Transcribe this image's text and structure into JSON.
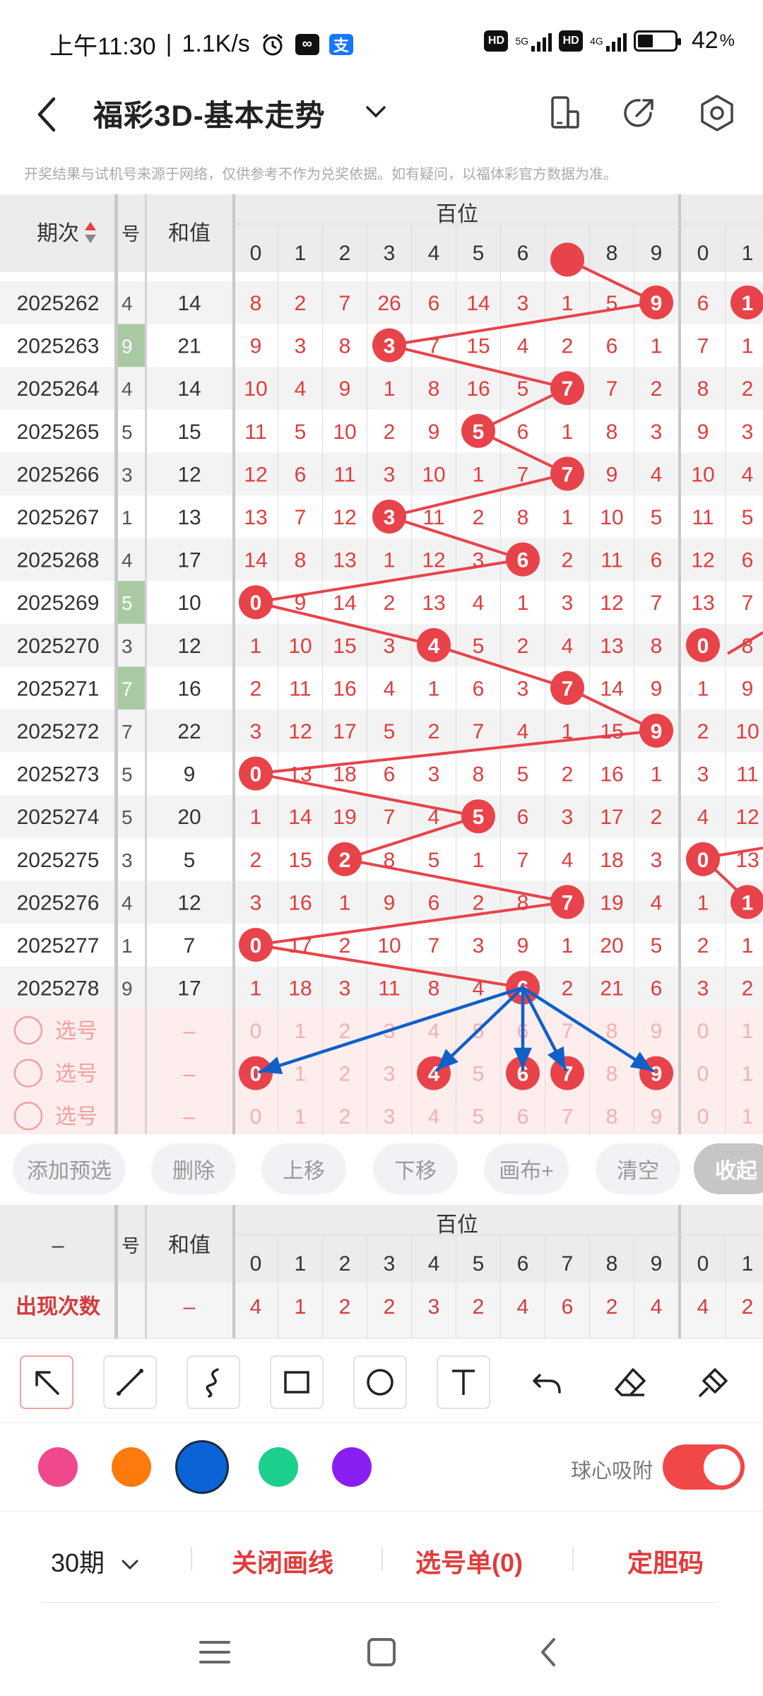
{
  "status_bar": {
    "time": "上午11:30",
    "separator": "|",
    "net_speed": "1.1K/s",
    "battery": "42",
    "battery_unit": "%",
    "hd1": "HD",
    "hd2": "HD",
    "net1": "5G",
    "net2": "4G",
    "icons": [
      "alarm-icon",
      "app-icon",
      "alipay-icon",
      "signal-icon",
      "battery-icon"
    ]
  },
  "app_bar": {
    "title": "福彩3D-基本走势"
  },
  "notice": "开奖结果与试机号来源于网络，仅供参考不作为兑奖依据。如有疑问，以福体彩官方数据为准。",
  "table": {
    "col_period": "期次",
    "col_sum": "和值",
    "group_label": "百位",
    "clip_col_label": "号",
    "digits": [
      "0",
      "1",
      "2",
      "3",
      "4",
      "5",
      "6",
      "7",
      "8",
      "9"
    ],
    "next_digits": [
      "0",
      "1"
    ],
    "rows": [
      {
        "period": "2025262",
        "clip": "4",
        "sum": "14",
        "cells": [
          "8",
          "2",
          "7",
          "26",
          "6",
          "14",
          "3",
          "1",
          "5",
          "9"
        ],
        "hit": 9,
        "next": [
          "6",
          "1"
        ],
        "next_hit": 1,
        "clip_hl": false
      },
      {
        "period": "2025263",
        "clip": "9",
        "sum": "21",
        "cells": [
          "9",
          "3",
          "8",
          "3",
          "7",
          "15",
          "4",
          "2",
          "6",
          "1"
        ],
        "hit": 3,
        "next": [
          "7",
          "1"
        ],
        "next_hit": -1,
        "clip_hl": true
      },
      {
        "period": "2025264",
        "clip": "4",
        "sum": "14",
        "cells": [
          "10",
          "4",
          "9",
          "1",
          "8",
          "16",
          "5",
          "7",
          "7",
          "2"
        ],
        "hit": 7,
        "next": [
          "8",
          "2"
        ],
        "next_hit": -1,
        "clip_hl": false
      },
      {
        "period": "2025265",
        "clip": "5",
        "sum": "15",
        "cells": [
          "11",
          "5",
          "10",
          "2",
          "9",
          "5",
          "6",
          "1",
          "8",
          "3"
        ],
        "hit": 5,
        "next": [
          "9",
          "3"
        ],
        "next_hit": -1,
        "clip_hl": false
      },
      {
        "period": "2025266",
        "clip": "3",
        "sum": "12",
        "cells": [
          "12",
          "6",
          "11",
          "3",
          "10",
          "1",
          "7",
          "7",
          "9",
          "4"
        ],
        "hit": 7,
        "next": [
          "10",
          "4"
        ],
        "next_hit": -1,
        "clip_hl": false
      },
      {
        "period": "2025267",
        "clip": "1",
        "sum": "13",
        "cells": [
          "13",
          "7",
          "12",
          "3",
          "11",
          "2",
          "8",
          "1",
          "10",
          "5"
        ],
        "hit": 3,
        "next": [
          "11",
          "5"
        ],
        "next_hit": -1,
        "clip_hl": false
      },
      {
        "period": "2025268",
        "clip": "4",
        "sum": "17",
        "cells": [
          "14",
          "8",
          "13",
          "1",
          "12",
          "3",
          "6",
          "2",
          "11",
          "6"
        ],
        "hit": 6,
        "next": [
          "12",
          "6"
        ],
        "next_hit": -1,
        "clip_hl": false
      },
      {
        "period": "2025269",
        "clip": "5",
        "sum": "10",
        "cells": [
          "0",
          "9",
          "14",
          "2",
          "13",
          "4",
          "1",
          "3",
          "12",
          "7"
        ],
        "hit": 0,
        "next": [
          "13",
          "7"
        ],
        "next_hit": -1,
        "clip_hl": true
      },
      {
        "period": "2025270",
        "clip": "3",
        "sum": "12",
        "cells": [
          "1",
          "10",
          "15",
          "3",
          "4",
          "5",
          "2",
          "4",
          "13",
          "8"
        ],
        "hit": 4,
        "next": [
          "0",
          "8"
        ],
        "next_hit": 0,
        "clip_hl": false
      },
      {
        "period": "2025271",
        "clip": "7",
        "sum": "16",
        "cells": [
          "2",
          "11",
          "16",
          "4",
          "1",
          "6",
          "3",
          "7",
          "14",
          "9"
        ],
        "hit": 7,
        "next": [
          "1",
          "9"
        ],
        "next_hit": -1,
        "clip_hl": true
      },
      {
        "period": "2025272",
        "clip": "7",
        "sum": "22",
        "cells": [
          "3",
          "12",
          "17",
          "5",
          "2",
          "7",
          "4",
          "1",
          "15",
          "9"
        ],
        "hit": 9,
        "next": [
          "2",
          "10"
        ],
        "next_hit": -1,
        "clip_hl": false
      },
      {
        "period": "2025273",
        "clip": "5",
        "sum": "9",
        "cells": [
          "0",
          "13",
          "18",
          "6",
          "3",
          "8",
          "5",
          "2",
          "16",
          "1"
        ],
        "hit": 0,
        "next": [
          "3",
          "11"
        ],
        "next_hit": -1,
        "clip_hl": false
      },
      {
        "period": "2025274",
        "clip": "5",
        "sum": "20",
        "cells": [
          "1",
          "14",
          "19",
          "7",
          "4",
          "5",
          "6",
          "3",
          "17",
          "2"
        ],
        "hit": 5,
        "next": [
          "4",
          "12"
        ],
        "next_hit": -1,
        "clip_hl": false
      },
      {
        "period": "2025275",
        "clip": "3",
        "sum": "5",
        "cells": [
          "2",
          "15",
          "2",
          "8",
          "5",
          "1",
          "7",
          "4",
          "18",
          "3"
        ],
        "hit": 2,
        "next": [
          "0",
          "13"
        ],
        "next_hit": 0,
        "clip_hl": false
      },
      {
        "period": "2025276",
        "clip": "4",
        "sum": "12",
        "cells": [
          "3",
          "16",
          "1",
          "9",
          "6",
          "2",
          "8",
          "7",
          "19",
          "4"
        ],
        "hit": 7,
        "next": [
          "1",
          "1"
        ],
        "next_hit": 1,
        "clip_hl": false
      },
      {
        "period": "2025277",
        "clip": "1",
        "sum": "7",
        "cells": [
          "0",
          "17",
          "2",
          "10",
          "7",
          "3",
          "9",
          "1",
          "20",
          "5"
        ],
        "hit": 0,
        "next": [
          "2",
          "1"
        ],
        "next_hit": -1,
        "clip_hl": false
      },
      {
        "period": "2025278",
        "clip": "9",
        "sum": "17",
        "cells": [
          "1",
          "18",
          "3",
          "11",
          "8",
          "4",
          "6",
          "2",
          "21",
          "6"
        ],
        "hit": 6,
        "next": [
          "3",
          "2"
        ],
        "next_hit": -1,
        "clip_hl": false
      }
    ],
    "select_rows": [
      {
        "label": "选号",
        "sum": "–",
        "picked": []
      },
      {
        "label": "选号",
        "sum": "–",
        "picked": [
          0,
          4,
          6,
          7,
          9
        ]
      },
      {
        "label": "选号",
        "sum": "–",
        "picked": []
      }
    ]
  },
  "buttons": [
    "添加预选",
    "删除",
    "上移",
    "下移",
    "画布+",
    "清空",
    "收起"
  ],
  "stats": {
    "header_left": "–",
    "col_sum": "和值",
    "group_label": "百位",
    "clip_col_label": "号",
    "row_label": "出现次数",
    "row_sum": "–",
    "counts": [
      "4",
      "1",
      "2",
      "2",
      "3",
      "2",
      "4",
      "6",
      "2",
      "4"
    ],
    "next_counts": [
      "4",
      "2"
    ]
  },
  "tools": [
    "pointer-arrow",
    "line",
    "freehand",
    "rectangle",
    "circle",
    "text",
    "undo",
    "eraser",
    "clear-all"
  ],
  "colors": {
    "swatches": [
      "#f0488c",
      "#ff7a0d",
      "#0a64d6",
      "#1ccf8c",
      "#8a1ef0"
    ],
    "selected": 2,
    "accent": "#e33b3b",
    "ball": "#e8434a",
    "arrow": "#1060c8"
  },
  "snap": {
    "label": "球心吸附",
    "on": true
  },
  "bottom": {
    "period": "30期",
    "close_draw": "关闭画线",
    "select_list": "选号单(0)",
    "fix_code": "定胆码"
  }
}
